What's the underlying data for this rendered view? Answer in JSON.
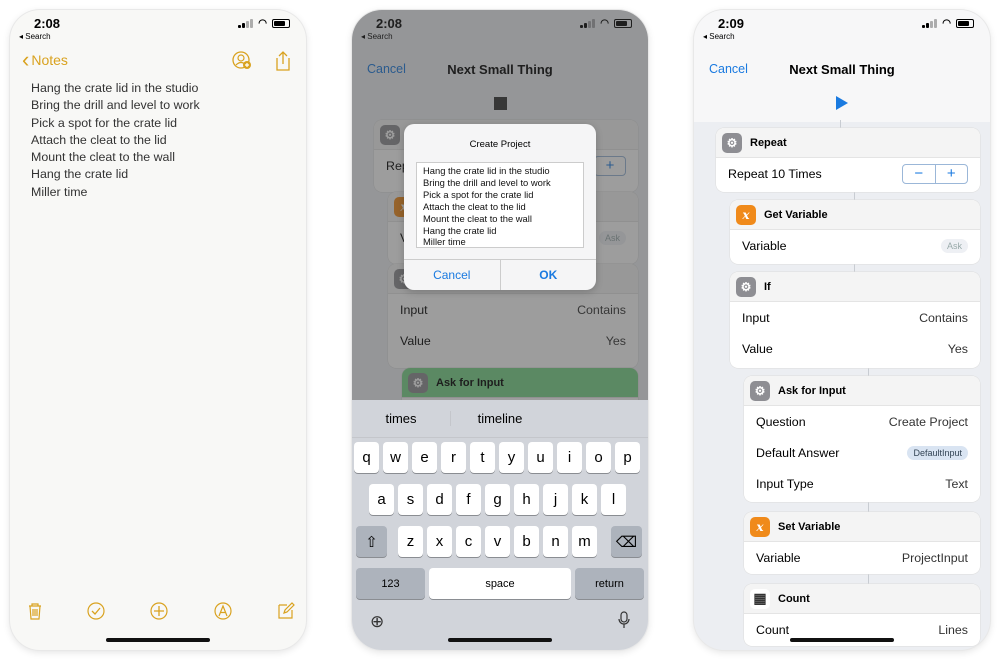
{
  "p1": {
    "time": "2:08",
    "back": "◂ Search",
    "nav_back": "Notes",
    "lines": [
      "Hang the crate lid in the studio",
      "Bring the drill and level to work",
      "Pick a spot for the crate lid",
      "Attach the cleat to the lid",
      "Mount the cleat to the wall",
      "Hang the crate lid",
      "Miller time"
    ]
  },
  "p2": {
    "time": "2:08",
    "back": "◂ Search",
    "cancel": "Cancel",
    "title": "Next Small Thing",
    "bg": {
      "repeat_partial": "Repe",
      "var_partial": "V",
      "ask": "Ask",
      "input": "Input",
      "contains": "Contains",
      "value": "Value",
      "yes": "Yes",
      "ask_input": "Ask for Input"
    },
    "dialog": {
      "title": "Create Project",
      "text": "Hang the crate lid in the studio\nBring the drill and level to work\nPick a spot for the crate lid\nAttach the cleat to the lid\nMount the cleat to the wall\nHang the crate lid\nMiller time",
      "cancel": "Cancel",
      "ok": "OK"
    },
    "suggestions": [
      "times",
      "timeline"
    ],
    "row1": [
      "q",
      "w",
      "e",
      "r",
      "t",
      "y",
      "u",
      "i",
      "o",
      "p"
    ],
    "row2": [
      "a",
      "s",
      "d",
      "f",
      "g",
      "h",
      "j",
      "k",
      "l"
    ],
    "row3": [
      "z",
      "x",
      "c",
      "v",
      "b",
      "n",
      "m"
    ],
    "k123": "123",
    "space": "space",
    "return": "return"
  },
  "p3": {
    "time": "2:09",
    "back": "◂ Search",
    "cancel": "Cancel",
    "title": "Next Small Thing",
    "repeat": {
      "title": "Repeat",
      "label": "Repeat 10 Times"
    },
    "getvar": {
      "title": "Get Variable",
      "label": "Variable",
      "value": "Ask"
    },
    "if": {
      "title": "If",
      "input": "Input",
      "input_v": "Contains",
      "value": "Value",
      "value_v": "Yes"
    },
    "askinput": {
      "title": "Ask for Input",
      "q": "Question",
      "q_v": "Create Project",
      "da": "Default Answer",
      "da_v": "DefaultInput",
      "it": "Input Type",
      "it_v": "Text"
    },
    "setvar": {
      "title": "Set Variable",
      "label": "Variable",
      "value": "ProjectInput"
    },
    "count": {
      "title": "Count",
      "label": "Count",
      "value": "Lines"
    }
  }
}
